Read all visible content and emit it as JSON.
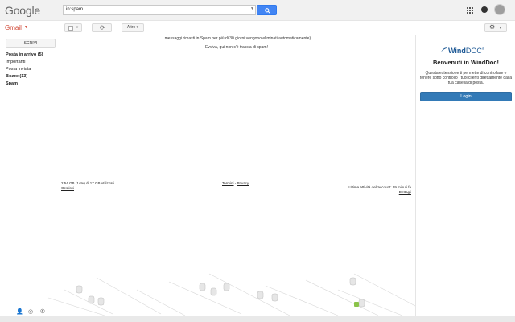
{
  "header": {
    "logo": "Google",
    "search_value": "in:spam",
    "app_label": "Gmail"
  },
  "toolbar": {
    "more_label": "Altro"
  },
  "compose_label": "SCRIVI",
  "nav": [
    {
      "label": "Posta in arrivo (5)",
      "bold": true
    },
    {
      "label": "Importanti",
      "bold": false
    },
    {
      "label": "Posta inviata",
      "bold": false
    },
    {
      "label": "Bozze (13)",
      "bold": true
    },
    {
      "label": "Spam",
      "bold": true
    }
  ],
  "main": {
    "notice": "I messaggi rimasti in Spam per più di 30 giorni vengono eliminati automaticamente)",
    "empty_state": "Evviva, qui non c'è traccia di spam!"
  },
  "footer": {
    "storage": "2.54 GB (14%) di 17 GB utilizzati",
    "manage": "Gestisci",
    "terms": "Termini",
    "separator": " - ",
    "privacy": "Privacy",
    "activity": "Ultima attività dell'account: 29 minuti fa",
    "details": "Dettagli"
  },
  "sidebar": {
    "logo_wind": "Wind",
    "logo_doc": "DOC",
    "logo_mark": "®",
    "title": "Benvenuti in WindDoc!",
    "description": "Questa estensione ti permette di controllare e tenere sotto controllo i tuoi clienti direttamente dalla tua casella di posta.",
    "login_label": "Login"
  },
  "colors": {
    "search_button": "#4285f4",
    "gmail_red": "#d14836",
    "login_button": "#337ab7",
    "winddoc_blue": "#1f5a96"
  }
}
